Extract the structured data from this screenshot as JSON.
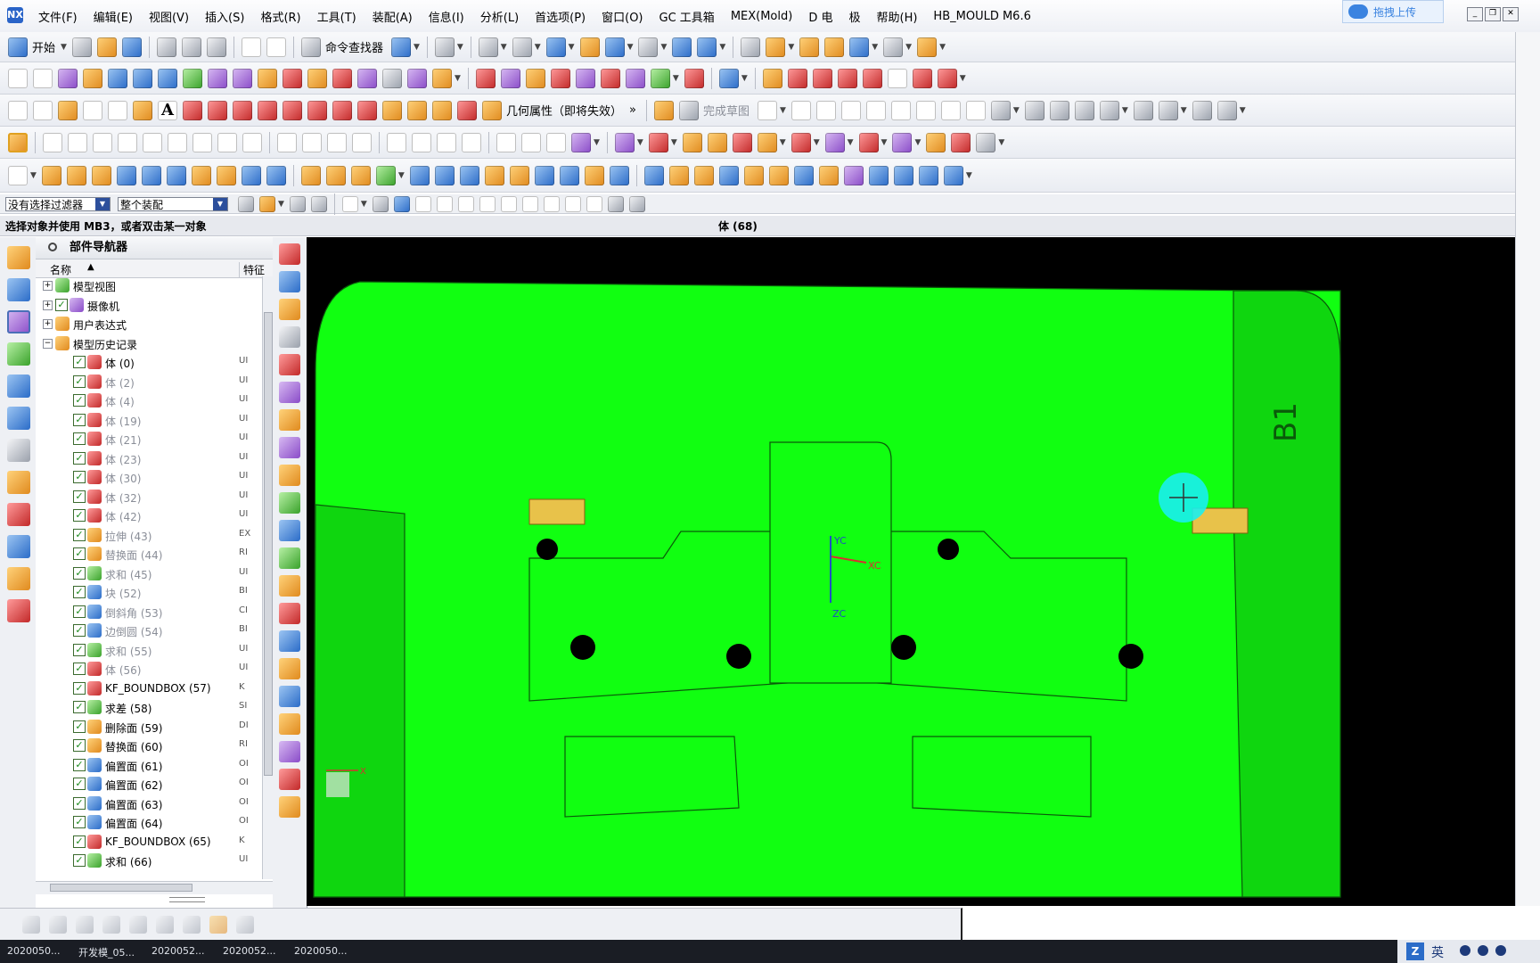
{
  "menubar": {
    "items": [
      "文件(F)",
      "编辑(E)",
      "视图(V)",
      "插入(S)",
      "格式(R)",
      "工具(T)",
      "装配(A)",
      "信息(I)",
      "分析(L)",
      "首选项(P)",
      "窗口(O)",
      "GC 工具箱",
      "MEX(Mold)",
      "D 电",
      "极",
      "帮助(H)",
      "HB_MOULD M6.6"
    ],
    "cloud_upload": "拖拽上传"
  },
  "toolbar1": {
    "start_label": "开始",
    "command_finder": "命令查找器"
  },
  "toolbar3": {
    "geom_props": "几何属性（即将失效）",
    "finish_sketch": "完成草图"
  },
  "selection_bar": {
    "filter_value": "没有选择过滤器",
    "scope_value": "整个装配"
  },
  "status": {
    "prompt": "选择对象并使用 MB3，或者双击某一对象",
    "selection": "体 (68)"
  },
  "navigator": {
    "title": "部件导航器",
    "col_name": "名称",
    "col_feature": "特征",
    "rows": [
      {
        "name": "模型视图",
        "level": 0,
        "expand": "+",
        "check": false,
        "icon": "model-view-icon",
        "color": "c-green",
        "gray": false,
        "feat": ""
      },
      {
        "name": "摄像机",
        "level": 0,
        "expand": "+",
        "check": true,
        "icon": "camera-icon",
        "color": "c-purple",
        "gray": false,
        "feat": ""
      },
      {
        "name": "用户表达式",
        "level": 0,
        "expand": "+",
        "check": false,
        "icon": "folder-icon",
        "color": "c-orange",
        "gray": false,
        "feat": ""
      },
      {
        "name": "模型历史记录",
        "level": 0,
        "expand": "-",
        "check": false,
        "icon": "folder-icon",
        "color": "c-orange",
        "gray": false,
        "feat": ""
      },
      {
        "name": "体 (0)",
        "level": 1,
        "expand": "",
        "check": true,
        "icon": "body-icon",
        "color": "c-red",
        "gray": false,
        "feat": "UI"
      },
      {
        "name": "体 (2)",
        "level": 1,
        "expand": "",
        "check": true,
        "icon": "body-icon",
        "color": "c-red",
        "gray": true,
        "feat": "UI"
      },
      {
        "name": "体 (4)",
        "level": 1,
        "expand": "",
        "check": true,
        "icon": "body-icon",
        "color": "c-red",
        "gray": true,
        "feat": "UI"
      },
      {
        "name": "体 (19)",
        "level": 1,
        "expand": "",
        "check": true,
        "icon": "body-icon",
        "color": "c-red",
        "gray": true,
        "feat": "UI"
      },
      {
        "name": "体 (21)",
        "level": 1,
        "expand": "",
        "check": true,
        "icon": "body-icon",
        "color": "c-red",
        "gray": true,
        "feat": "UI"
      },
      {
        "name": "体 (23)",
        "level": 1,
        "expand": "",
        "check": true,
        "icon": "body-icon",
        "color": "c-red",
        "gray": true,
        "feat": "UI"
      },
      {
        "name": "体 (30)",
        "level": 1,
        "expand": "",
        "check": true,
        "icon": "body-icon",
        "color": "c-red",
        "gray": true,
        "feat": "UI"
      },
      {
        "name": "体 (32)",
        "level": 1,
        "expand": "",
        "check": true,
        "icon": "body-icon",
        "color": "c-red",
        "gray": true,
        "feat": "UI"
      },
      {
        "name": "体 (42)",
        "level": 1,
        "expand": "",
        "check": true,
        "icon": "body-icon",
        "color": "c-red",
        "gray": true,
        "feat": "UI"
      },
      {
        "name": "拉伸 (43)",
        "level": 1,
        "expand": "",
        "check": true,
        "icon": "extrude-icon",
        "color": "c-orange",
        "gray": true,
        "feat": "EX"
      },
      {
        "name": "替换面 (44)",
        "level": 1,
        "expand": "",
        "check": true,
        "icon": "replace-face-icon",
        "color": "c-orange",
        "gray": true,
        "feat": "RI"
      },
      {
        "name": "求和 (45)",
        "level": 1,
        "expand": "",
        "check": true,
        "icon": "unite-icon",
        "color": "c-green",
        "gray": true,
        "feat": "UI"
      },
      {
        "name": "块 (52)",
        "level": 1,
        "expand": "",
        "check": true,
        "icon": "block-icon",
        "color": "c-blue",
        "gray": true,
        "feat": "BI"
      },
      {
        "name": "倒斜角 (53)",
        "level": 1,
        "expand": "",
        "check": true,
        "icon": "chamfer-icon",
        "color": "c-blue",
        "gray": true,
        "feat": "CI"
      },
      {
        "name": "边倒圆 (54)",
        "level": 1,
        "expand": "",
        "check": true,
        "icon": "blend-icon",
        "color": "c-blue",
        "gray": true,
        "feat": "BI"
      },
      {
        "name": "求和 (55)",
        "level": 1,
        "expand": "",
        "check": true,
        "icon": "unite-icon",
        "color": "c-green",
        "gray": true,
        "feat": "UI"
      },
      {
        "name": "体 (56)",
        "level": 1,
        "expand": "",
        "check": true,
        "icon": "body-icon",
        "color": "c-red",
        "gray": true,
        "feat": "UI"
      },
      {
        "name": "KF_BOUNDBOX (57)",
        "level": 1,
        "expand": "",
        "check": true,
        "icon": "boundbox-icon",
        "color": "c-red",
        "gray": false,
        "feat": "K"
      },
      {
        "name": "求差 (58)",
        "level": 1,
        "expand": "",
        "check": true,
        "icon": "subtract-icon",
        "color": "c-green",
        "gray": false,
        "feat": "SI"
      },
      {
        "name": "删除面 (59)",
        "level": 1,
        "expand": "",
        "check": true,
        "icon": "delete-face-icon",
        "color": "c-orange",
        "gray": false,
        "feat": "DI"
      },
      {
        "name": "替换面 (60)",
        "level": 1,
        "expand": "",
        "check": true,
        "icon": "replace-face-icon",
        "color": "c-orange",
        "gray": false,
        "feat": "RI"
      },
      {
        "name": "偏置面 (61)",
        "level": 1,
        "expand": "",
        "check": true,
        "icon": "offset-face-icon",
        "color": "c-blue",
        "gray": false,
        "feat": "OI"
      },
      {
        "name": "偏置面 (62)",
        "level": 1,
        "expand": "",
        "check": true,
        "icon": "offset-face-icon",
        "color": "c-blue",
        "gray": false,
        "feat": "OI"
      },
      {
        "name": "偏置面 (63)",
        "level": 1,
        "expand": "",
        "check": true,
        "icon": "offset-face-icon",
        "color": "c-blue",
        "gray": false,
        "feat": "OI"
      },
      {
        "name": "偏置面 (64)",
        "level": 1,
        "expand": "",
        "check": true,
        "icon": "offset-face-icon",
        "color": "c-blue",
        "gray": false,
        "feat": "OI"
      },
      {
        "name": "KF_BOUNDBOX (65)",
        "level": 1,
        "expand": "",
        "check": true,
        "icon": "boundbox-icon",
        "color": "c-red",
        "gray": false,
        "feat": "K"
      },
      {
        "name": "求和 (66)",
        "level": 1,
        "expand": "",
        "check": true,
        "icon": "unite-icon",
        "color": "c-green",
        "gray": false,
        "feat": "UI"
      }
    ]
  },
  "viewport": {
    "part_label": "B1",
    "axis_yc": "YC",
    "axis_xc": "XC",
    "axis_zc": "ZC",
    "triad_x": "X",
    "colors": {
      "part_fill": "#11ff11",
      "part_edge": "#0a5a0a",
      "highlight": "#e8c24a",
      "cursor": "#19f0f0"
    }
  },
  "taskbar": {
    "items": [
      "2020050...",
      "开发模_05...",
      "2020052...",
      "2020052...",
      "2020050..."
    ],
    "ime": "英"
  }
}
